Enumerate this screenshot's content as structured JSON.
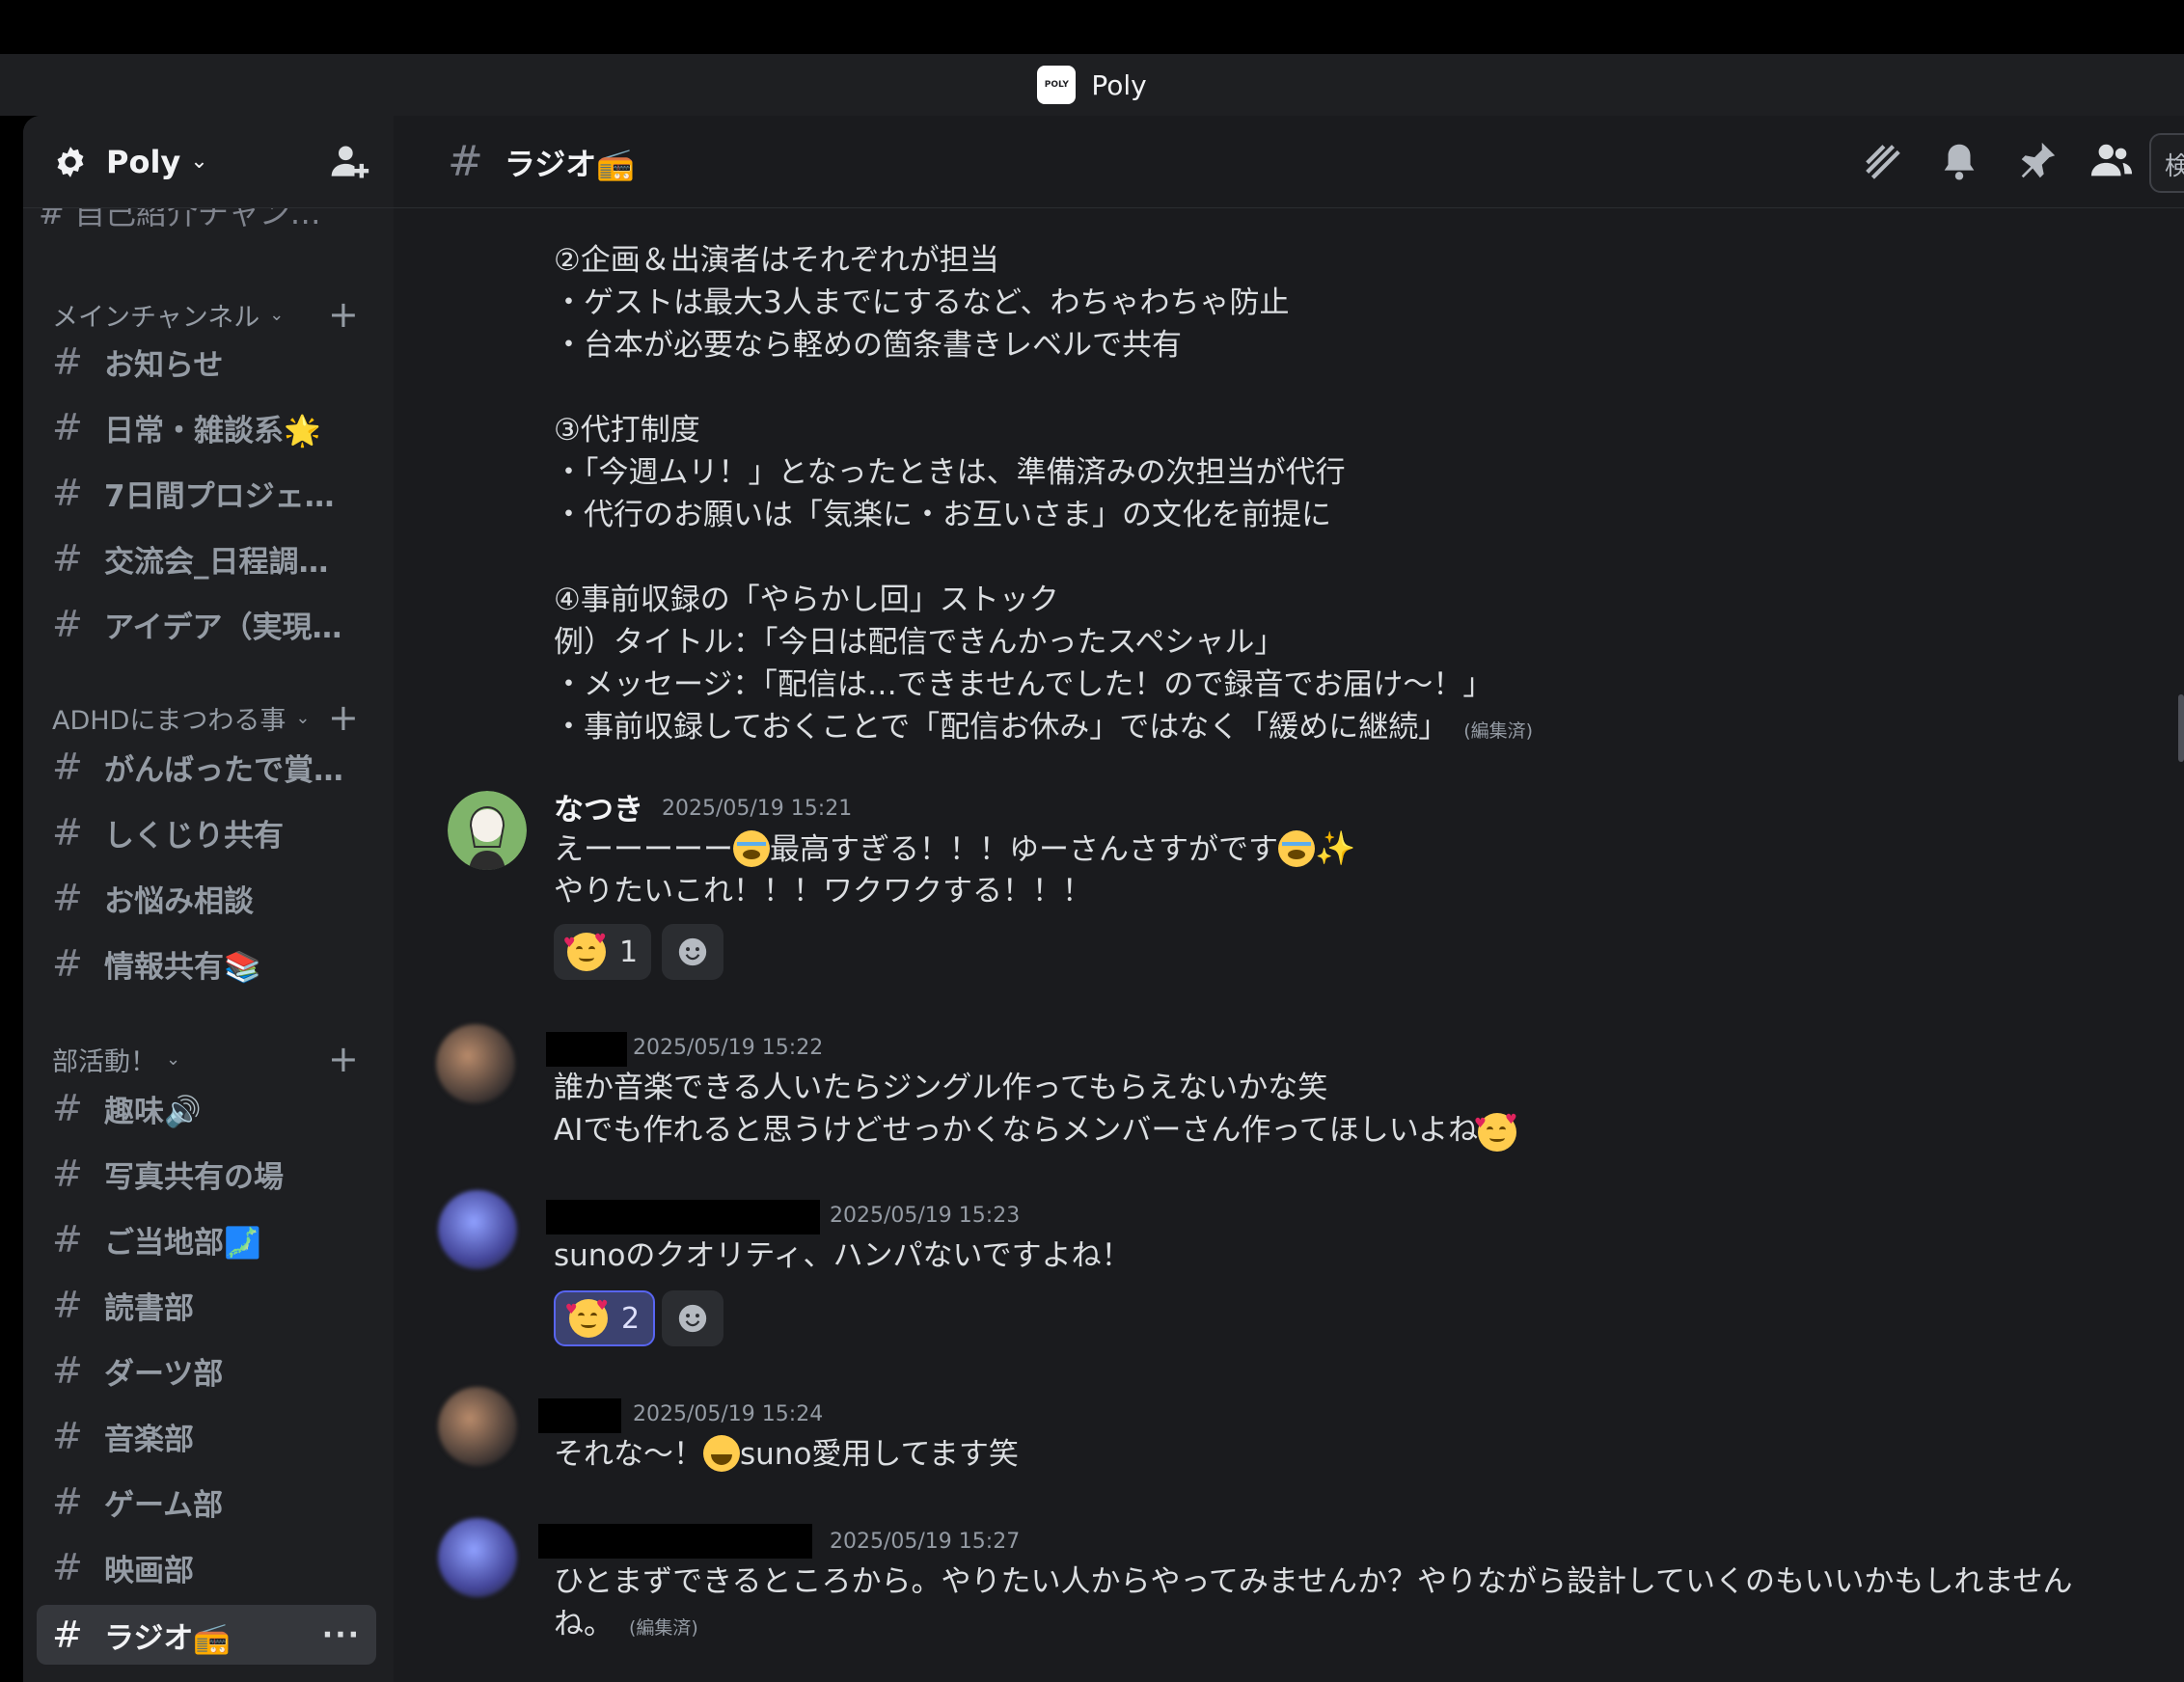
{
  "window": {
    "title": "Poly",
    "logo_text": "POLY"
  },
  "server": {
    "name": "Poly"
  },
  "sidebar": {
    "cut_off_channel": "# 自己紹介チャン…",
    "categories": [
      {
        "label": "メインチャンネル",
        "channels": [
          "お知らせ",
          "日常・雑談系🌟",
          "7日間プロジェ…",
          "交流会_日程調…",
          "アイデア（実現…"
        ]
      },
      {
        "label": "ADHDにまつわる事",
        "channels": [
          "がんばったで賞…",
          "しくじり共有",
          "お悩み相談",
          "情報共有📚"
        ]
      },
      {
        "label": "部活動！",
        "channels": [
          "趣味🔊",
          "写真共有の場",
          "ご当地部🗾",
          "読書部",
          "ダーツ部",
          "音楽部",
          "ゲーム部",
          "映画部",
          "ラジオ📻"
        ]
      }
    ],
    "more_glyph": "···"
  },
  "header": {
    "channel_name": "ラジオ📻",
    "search_text": "検"
  },
  "messages": {
    "m0": {
      "lines": [
        "②企画＆出演者はそれぞれが担当",
        "・ゲストは最大3人までにするなど、わちゃわちゃ防止",
        "・台本が必要なら軽めの箇条書きレベルで共有",
        "③代打制度",
        "・「今週ムリ！」となったときは、準備済みの次担当が代行",
        "・代行のお願いは「気楽に・お互いさま」の文化を前提に",
        "④事前収録の「やらかし回」ストック",
        "例）タイトル：「今日は配信できんかったスペシャル」",
        "・メッセージ：「配信は…できませんでした！ので録音でお届け〜！」",
        "・事前収録しておくことで「配信お休み」ではなく「緩めに継続」"
      ],
      "edited": "(編集済)"
    },
    "m1": {
      "author": "なつき",
      "timestamp": "2025/05/19 15:21",
      "line1a": "えーーーーー",
      "line1b": "最高すぎる！！！ゆーさんさすがです",
      "line2": "やりたいこれ！！！ワクワクする！！！",
      "reaction_count": "1"
    },
    "m2": {
      "timestamp": "2025/05/19 15:22",
      "line1": "誰か音楽できる人いたらジングル作ってもらえないかな笑",
      "line2": "AIでも作れると思うけどせっかくならメンバーさん作ってほしいよね"
    },
    "m3": {
      "timestamp": "2025/05/19 15:23",
      "line1": "sunoのクオリティ、ハンパないですよね！",
      "reaction_count": "2"
    },
    "m4": {
      "timestamp": "2025/05/19 15:24",
      "line1a": "それな〜！",
      "line1b": "suno愛用してます笑"
    },
    "m5": {
      "timestamp": "2025/05/19 15:27",
      "line1": "ひとまずできるところから。やりたい人からやってみませんか？やりながら設計していくのもいいかもしれません",
      "line2": "ね。",
      "edited": "(編集済)"
    }
  },
  "colors": {
    "accent": "#5865f2",
    "background": "#1a1b1e",
    "sidebar": "#1e1f22"
  }
}
